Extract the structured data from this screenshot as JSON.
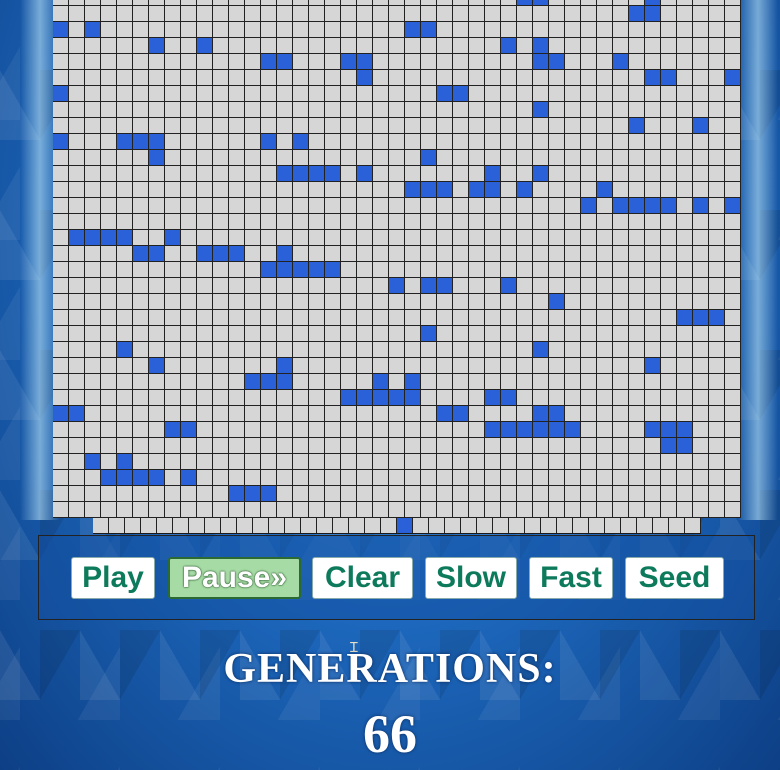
{
  "controls": {
    "play_label": "Play",
    "pause_label": "Pause»",
    "clear_label": "Clear",
    "slow_label": "Slow",
    "fast_label": "Fast",
    "seed_label": "Seed",
    "active_button": "pause"
  },
  "status": {
    "generations_label": "GENERATIONS:",
    "generations_count": "66"
  },
  "colors": {
    "live_cell": "#2a61d8",
    "dead_cell": "#d6d6d6",
    "active_button_bg": "#a7dba5",
    "button_text": "#0e7a5c"
  },
  "board": {
    "live_cells": [
      [
        0,
        29
      ],
      [
        0,
        30
      ],
      [
        0,
        37
      ],
      [
        1,
        36
      ],
      [
        1,
        37
      ],
      [
        2,
        0
      ],
      [
        2,
        2
      ],
      [
        2,
        22
      ],
      [
        2,
        23
      ],
      [
        3,
        6
      ],
      [
        3,
        9
      ],
      [
        3,
        28
      ],
      [
        3,
        30
      ],
      [
        4,
        13
      ],
      [
        4,
        14
      ],
      [
        4,
        18
      ],
      [
        4,
        19
      ],
      [
        4,
        30
      ],
      [
        4,
        31
      ],
      [
        4,
        35
      ],
      [
        5,
        19
      ],
      [
        5,
        37
      ],
      [
        5,
        38
      ],
      [
        5,
        42
      ],
      [
        6,
        0
      ],
      [
        6,
        24
      ],
      [
        6,
        25
      ],
      [
        7,
        30
      ],
      [
        8,
        36
      ],
      [
        8,
        40
      ],
      [
        9,
        0
      ],
      [
        9,
        4
      ],
      [
        9,
        5
      ],
      [
        9,
        6
      ],
      [
        9,
        13
      ],
      [
        9,
        15
      ],
      [
        10,
        6
      ],
      [
        10,
        23
      ],
      [
        11,
        14
      ],
      [
        11,
        15
      ],
      [
        11,
        16
      ],
      [
        11,
        17
      ],
      [
        11,
        19
      ],
      [
        11,
        27
      ],
      [
        11,
        30
      ],
      [
        12,
        22
      ],
      [
        12,
        23
      ],
      [
        12,
        24
      ],
      [
        12,
        26
      ],
      [
        12,
        27
      ],
      [
        12,
        29
      ],
      [
        12,
        34
      ],
      [
        13,
        33
      ],
      [
        13,
        35
      ],
      [
        13,
        36
      ],
      [
        13,
        37
      ],
      [
        13,
        38
      ],
      [
        13,
        40
      ],
      [
        13,
        42
      ],
      [
        15,
        1
      ],
      [
        15,
        2
      ],
      [
        15,
        3
      ],
      [
        15,
        4
      ],
      [
        15,
        7
      ],
      [
        16,
        5
      ],
      [
        16,
        6
      ],
      [
        16,
        9
      ],
      [
        16,
        10
      ],
      [
        16,
        11
      ],
      [
        16,
        14
      ],
      [
        17,
        13
      ],
      [
        17,
        14
      ],
      [
        17,
        15
      ],
      [
        17,
        16
      ],
      [
        17,
        17
      ],
      [
        18,
        21
      ],
      [
        18,
        23
      ],
      [
        18,
        24
      ],
      [
        18,
        28
      ],
      [
        19,
        31
      ],
      [
        20,
        39
      ],
      [
        20,
        40
      ],
      [
        20,
        41
      ],
      [
        21,
        23
      ],
      [
        22,
        4
      ],
      [
        22,
        30
      ],
      [
        23,
        6
      ],
      [
        23,
        14
      ],
      [
        23,
        37
      ],
      [
        24,
        12
      ],
      [
        24,
        13
      ],
      [
        24,
        14
      ],
      [
        24,
        20
      ],
      [
        24,
        22
      ],
      [
        25,
        18
      ],
      [
        25,
        19
      ],
      [
        25,
        20
      ],
      [
        25,
        21
      ],
      [
        25,
        22
      ],
      [
        25,
        27
      ],
      [
        25,
        28
      ],
      [
        26,
        0
      ],
      [
        26,
        1
      ],
      [
        26,
        24
      ],
      [
        26,
        25
      ],
      [
        26,
        30
      ],
      [
        26,
        31
      ],
      [
        27,
        7
      ],
      [
        27,
        8
      ],
      [
        27,
        27
      ],
      [
        27,
        28
      ],
      [
        27,
        29
      ],
      [
        27,
        30
      ],
      [
        27,
        31
      ],
      [
        27,
        32
      ],
      [
        27,
        37
      ],
      [
        27,
        38
      ],
      [
        27,
        39
      ],
      [
        28,
        38
      ],
      [
        28,
        39
      ],
      [
        29,
        2
      ],
      [
        29,
        4
      ],
      [
        30,
        3
      ],
      [
        30,
        4
      ],
      [
        30,
        5
      ],
      [
        30,
        6
      ],
      [
        30,
        8
      ],
      [
        31,
        11
      ],
      [
        31,
        12
      ],
      [
        31,
        13
      ]
    ],
    "bottom_row_live": [
      19
    ]
  }
}
